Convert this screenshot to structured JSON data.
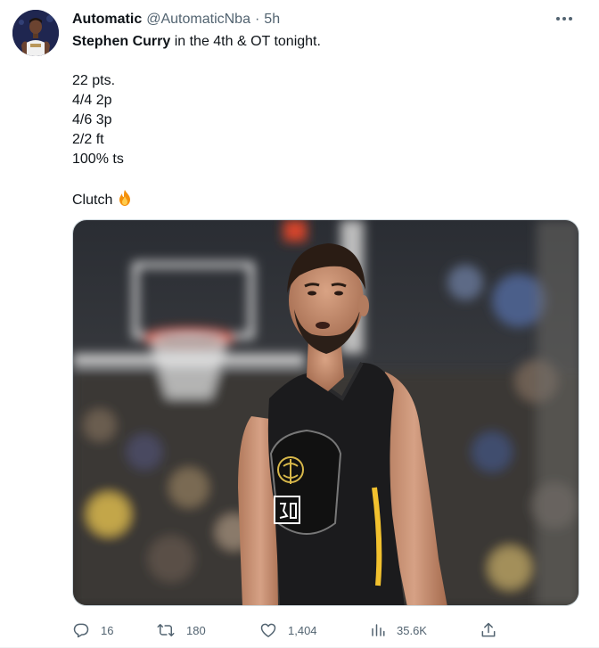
{
  "tweet": {
    "display_name": "Automatic",
    "handle": "@AutomaticNba",
    "separator": "·",
    "time": "5h",
    "text": {
      "mention": "Stephen Curry",
      "line1_rest": " in the 4th & OT tonight.",
      "stats": [
        "22 pts.",
        "4/4 2p",
        "4/6 3p",
        "2/2 ft",
        "100% ts"
      ],
      "closing": "Clutch"
    },
    "actions": {
      "replies": "16",
      "retweets": "180",
      "likes": "1,404",
      "views": "35.6K"
    }
  },
  "icons": {
    "more": "more-horizontal-icon",
    "reply": "reply-icon",
    "retweet": "retweet-icon",
    "like": "heart-icon",
    "views": "views-chart-icon",
    "share": "share-icon",
    "emoji": "fire-icon"
  },
  "colors": {
    "text_primary": "#0f1419",
    "text_secondary": "#536471",
    "divider": "#eff3f4",
    "jersey": "#1a1a1a",
    "jersey_accent": "#f2c12e"
  }
}
